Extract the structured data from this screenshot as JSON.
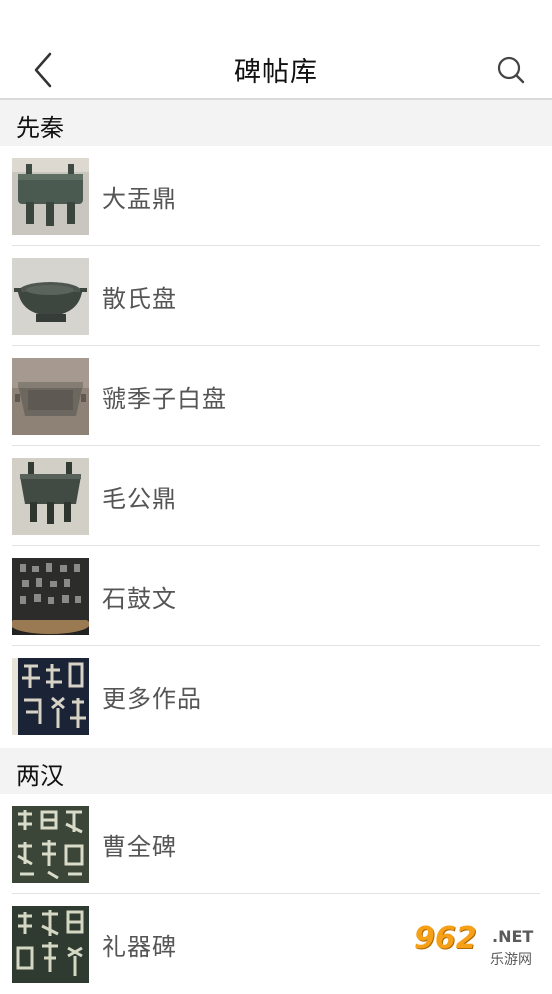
{
  "header": {
    "title": "碑帖库",
    "back_icon": "chevron-left-icon",
    "search_icon": "search-icon"
  },
  "sections": [
    {
      "title": "先秦",
      "items": [
        {
          "label": "大盂鼎",
          "thumb": "bronze-ding-icon"
        },
        {
          "label": "散氏盘",
          "thumb": "bronze-basin-icon"
        },
        {
          "label": "虢季子白盘",
          "thumb": "bronze-tray-icon"
        },
        {
          "label": "毛公鼎",
          "thumb": "bronze-ding-icon"
        },
        {
          "label": "石鼓文",
          "thumb": "stone-drum-icon"
        },
        {
          "label": "更多作品",
          "thumb": "calligraphy-rubbing-icon"
        }
      ]
    },
    {
      "title": "两汉",
      "items": [
        {
          "label": "曹全碑",
          "thumb": "stele-rubbing-icon"
        },
        {
          "label": "礼器碑",
          "thumb": "stele-rubbing-icon"
        }
      ]
    }
  ],
  "watermark": {
    "number": "962",
    "domain": ".NET",
    "subtitle": "乐游网"
  },
  "colors": {
    "accent_watermark": "#f6a018",
    "section_bg": "#f3f3f3",
    "label_text": "#555555"
  }
}
